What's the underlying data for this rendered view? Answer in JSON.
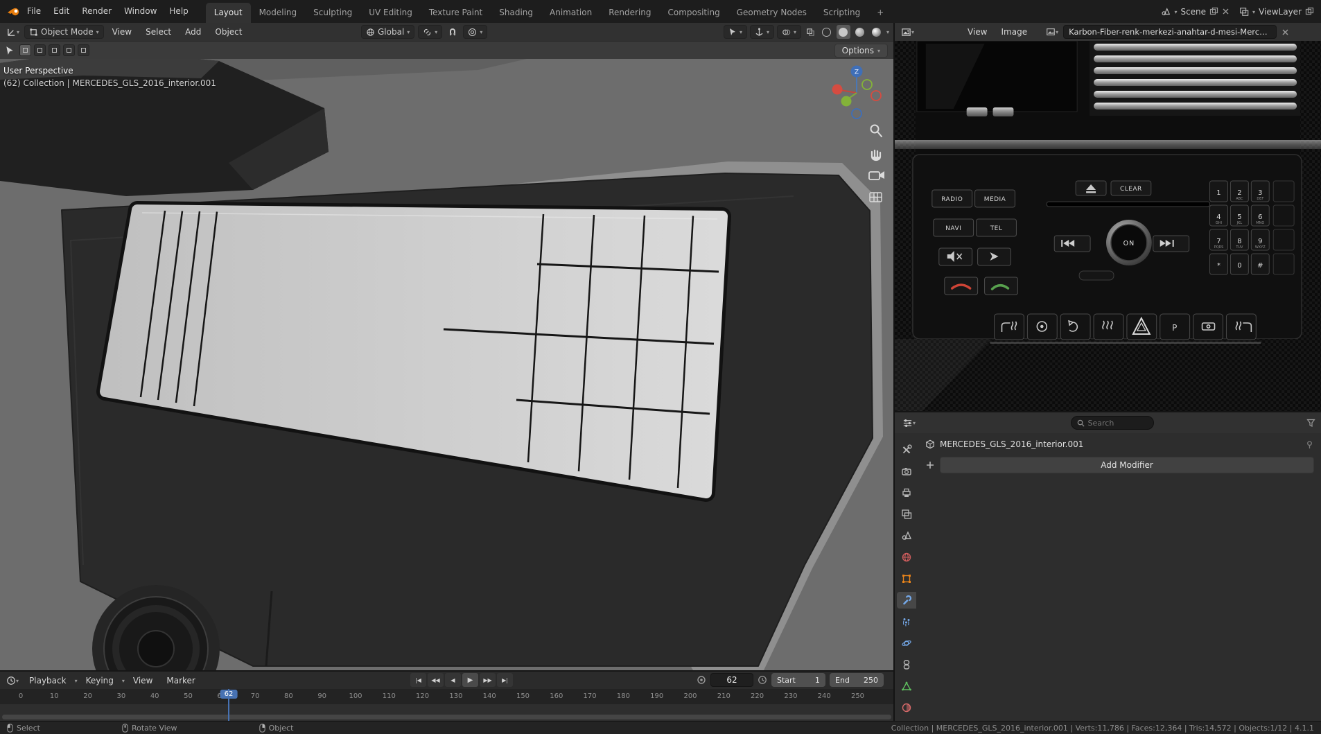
{
  "colors": {
    "accent": "#4772b3",
    "object_orange": "#e8831a",
    "modifier_blue": "#74a8e8",
    "data_green": "#5fbf5f",
    "world_red": "#cf5d5d"
  },
  "topbar": {
    "menus": [
      "File",
      "Edit",
      "Render",
      "Window",
      "Help"
    ],
    "tabs": [
      "Layout",
      "Modeling",
      "Sculpting",
      "UV Editing",
      "Texture Paint",
      "Shading",
      "Animation",
      "Rendering",
      "Compositing",
      "Geometry Nodes",
      "Scripting"
    ],
    "add_tab": "+",
    "scene_label": "Scene",
    "viewlayer_label": "ViewLayer"
  },
  "viewport": {
    "mode_label": "Object Mode",
    "menus": [
      "View",
      "Select",
      "Add",
      "Object"
    ],
    "orientation_label": "Global",
    "options_label": "Options",
    "overlay_perspective": "User Perspective",
    "overlay_collection": "(62) Collection | MERCEDES_GLS_2016_interior.001",
    "gizmo_axis_label": "Z"
  },
  "image_editor": {
    "menus": [
      "View",
      "Image"
    ],
    "image_name": "Karbon-Fiber-renk-merkezi-anahtar-d-mesi-Mercedes-Benz-ML...",
    "photo": {
      "btn_radio": "RADIO",
      "btn_media": "MEDIA",
      "btn_navi": "NAVI",
      "btn_tel": "TEL",
      "btn_clear": "CLEAR",
      "knob_label": "ON",
      "switch_parking_label": "P",
      "keypad_digits": [
        "1",
        "2",
        "3",
        "4",
        "5",
        "6",
        "7",
        "8",
        "9",
        "*",
        "0",
        "#"
      ],
      "keypad_letters": [
        "",
        "ABC",
        "DEF",
        "GHI",
        "JKL",
        "MNO",
        "PQRS",
        "TUV",
        "WXYZ"
      ]
    }
  },
  "properties": {
    "search_placeholder": "Search",
    "object_name": "MERCEDES_GLS_2016_interior.001",
    "add_modifier_label": "Add Modifier",
    "tab_icons": [
      "tool",
      "render",
      "output",
      "view-layer",
      "scene",
      "world",
      "object",
      "modifiers",
      "particles",
      "physics",
      "constraints",
      "object-data",
      "material"
    ],
    "active_tab": "modifiers"
  },
  "timeline": {
    "menus": [
      "Playback",
      "Keying",
      "View",
      "Marker"
    ],
    "transport": [
      "|◀",
      "◀◀",
      "◀",
      "▶",
      "▶▶",
      "▶|"
    ],
    "current_frame": "62",
    "playhead_label": "62",
    "playhead_frame": 62,
    "start_label": "Start",
    "start_value": "1",
    "end_label": "End",
    "end_value": "250",
    "ruler_labels": [
      "0",
      "10",
      "20",
      "30",
      "40",
      "50",
      "60",
      "70",
      "80",
      "90",
      "100",
      "110",
      "120",
      "130",
      "140",
      "150",
      "160",
      "170",
      "180",
      "190",
      "200",
      "210",
      "220",
      "230",
      "240",
      "250"
    ]
  },
  "statusbar": {
    "hints": [
      "Select",
      "Rotate View",
      "Object"
    ],
    "stats": "Collection | MERCEDES_GLS_2016_interior.001 | Verts:11,786 | Faces:12,364 | Tris:14,572 | Objects:1/12 | 4.1.1"
  }
}
